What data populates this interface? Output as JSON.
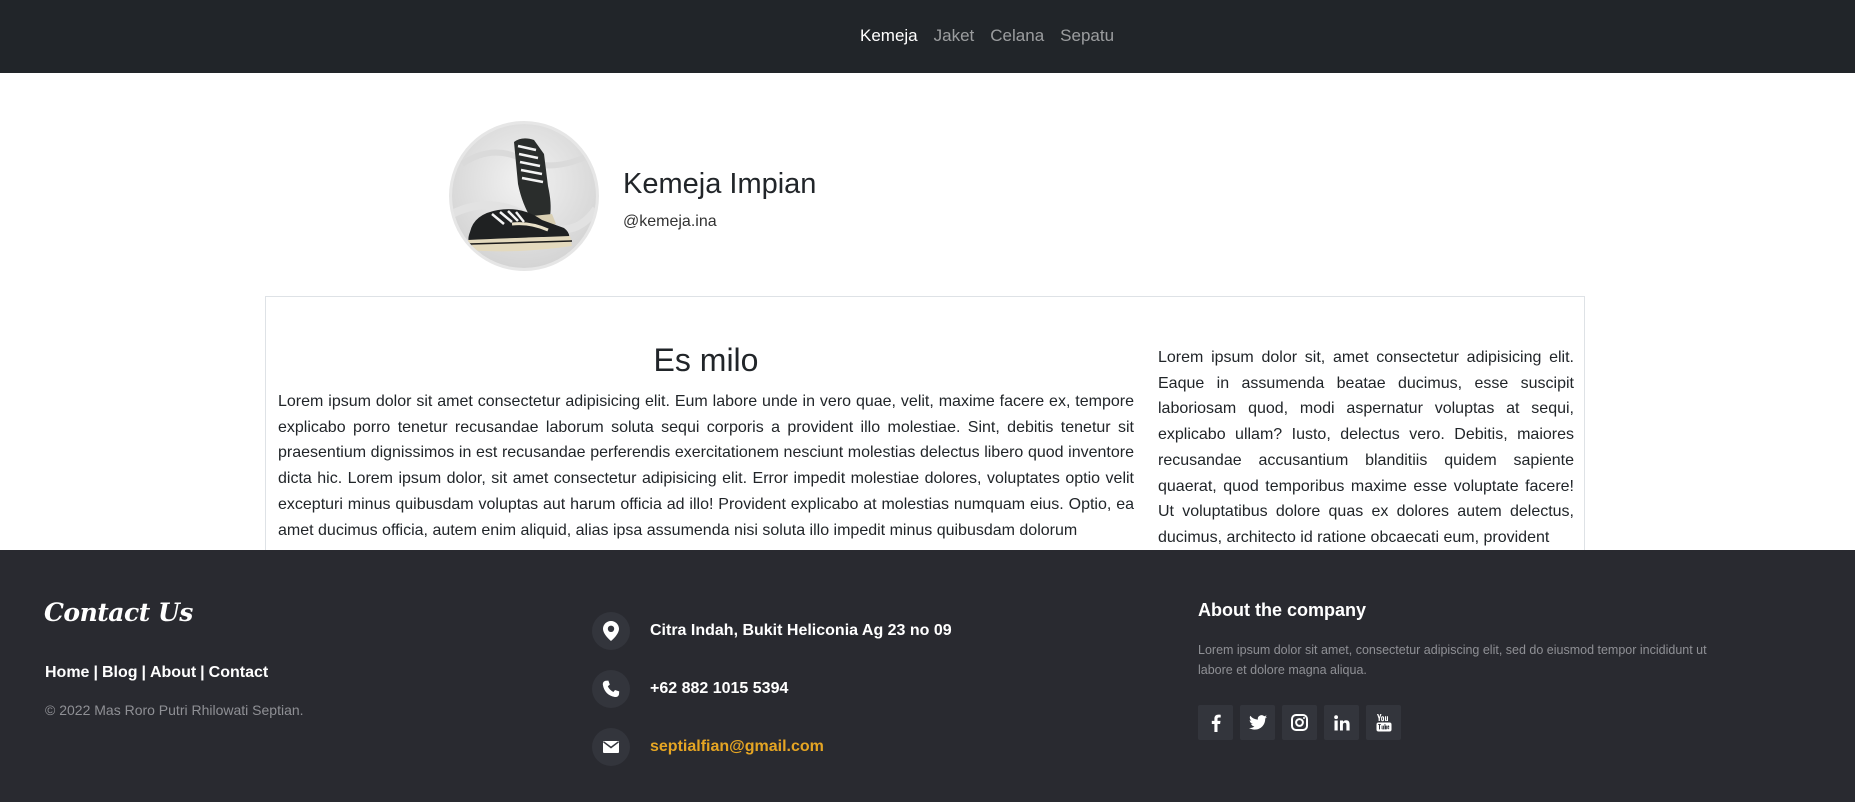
{
  "nav": {
    "items": [
      {
        "label": "Kemeja",
        "active": true
      },
      {
        "label": "Jaket",
        "active": false
      },
      {
        "label": "Celana",
        "active": false
      },
      {
        "label": "Sepatu",
        "active": false
      }
    ]
  },
  "profile": {
    "name": "Kemeja Impian",
    "handle": "@kemeja.ina",
    "avatar_icon": "sneakers-photo"
  },
  "article": {
    "title": "Es milo",
    "left_text": "Lorem ipsum dolor sit amet consectetur adipisicing elit. Eum labore unde in vero quae, velit, maxime facere ex, tempore explicabo porro tenetur recusandae laborum soluta sequi corporis a provident illo molestiae. Sint, debitis tenetur sit praesentium dignissimos in est recusandae perferendis exercitationem nesciunt molestias delectus libero quod inventore dicta hic. Lorem ipsum dolor, sit amet consectetur adipisicing elit. Error impedit molestiae dolores, voluptates optio velit excepturi minus quibusdam voluptas aut harum officia ad illo! Provident explicabo at molestias numquam eius. Optio, ea amet ducimus officia, autem enim aliquid, alias ipsa assumenda nisi soluta illo impedit minus quibusdam dolorum",
    "right_text": "Lorem ipsum dolor sit, amet consectetur adipisicing elit. Eaque in assumenda beatae ducimus, esse suscipit laboriosam quod, modi aspernatur voluptas at sequi, explicabo ullam? Iusto, delectus vero. Debitis, maiores recusandae accusantium blanditiis quidem sapiente quaerat, quod temporibus maxime esse voluptate facere! Ut voluptatibus dolore quas ex dolores autem delectus, ducimus, architecto id ratione obcaecati eum, provident"
  },
  "footer": {
    "contact_title": "Contact Us",
    "links": [
      "Home",
      "Blog",
      "About",
      "Contact"
    ],
    "link_separator": "|",
    "copyright": "© 2022 Mas Roro Putri Rhilowati Septian.",
    "address": "Citra Indah, Bukit Heliconia Ag 23 no 09",
    "phone": "+62 882 1015 5394",
    "email": "septialfian@gmail.com",
    "about_title": "About the company",
    "about_text": "Lorem ipsum dolor sit amet, consectetur adipiscing elit, sed do eiusmod tempor incididunt ut labore et dolore magna aliqua.",
    "socials": [
      "facebook-icon",
      "twitter-icon",
      "instagram-icon",
      "linkedin-icon",
      "youtube-icon"
    ],
    "colors": {
      "background": "#292a30",
      "email": "#e5a523",
      "muted": "#8f9095"
    }
  },
  "colors": {
    "navbar": "#212529",
    "nav_active": "#ffffff",
    "nav_inactive": "rgba(255,255,255,0.55)"
  }
}
